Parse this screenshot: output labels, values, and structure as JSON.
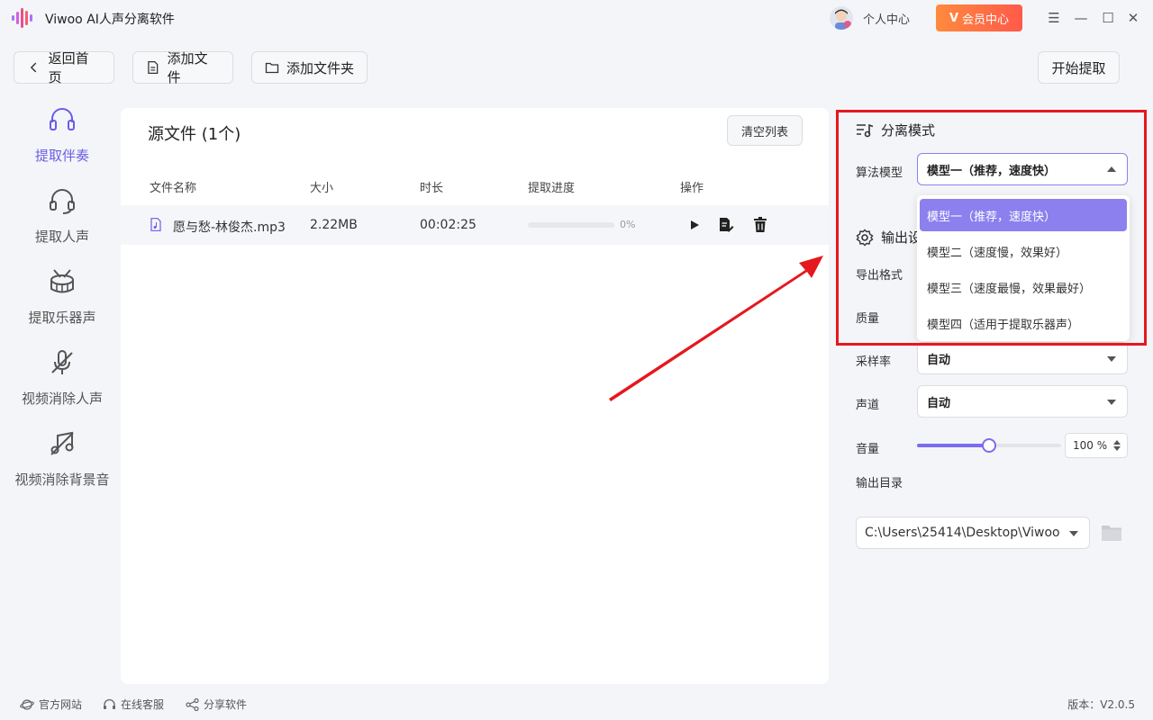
{
  "app": {
    "title": "Viwoo AI人声分离软件"
  },
  "titlebar": {
    "personal_center": "个人中心",
    "vip_center": "会员中心"
  },
  "toolbar": {
    "back": "返回首页",
    "add_file": "添加文件",
    "add_folder": "添加文件夹",
    "start": "开始提取"
  },
  "sidebar": {
    "items": [
      {
        "label": "提取伴奏",
        "active": true
      },
      {
        "label": "提取人声"
      },
      {
        "label": "提取乐器声"
      },
      {
        "label": "视频消除人声"
      },
      {
        "label": "视频消除背景音"
      }
    ]
  },
  "main": {
    "title": "源文件 (1个)",
    "clear_button": "清空列表",
    "columns": [
      "文件名称",
      "大小",
      "时长",
      "提取进度",
      "操作"
    ],
    "rows": [
      {
        "name": "愿与愁-林俊杰.mp3",
        "size": "2.22MB",
        "duration": "00:02:25",
        "progress_label": "0%",
        "progress": 0
      }
    ]
  },
  "settings": {
    "separation_title": "分离模式",
    "algorithm_label": "算法模型",
    "algorithm_value": "模型一（推荐，速度快）",
    "algorithm_options": [
      "模型一（推荐，速度快）",
      "模型二（速度慢，效果好）",
      "模型三（速度最慢，效果最好）",
      "模型四（适用于提取乐器声）"
    ],
    "output_title_visible": "输出设",
    "format_label": "导出格式",
    "quality_label": "质量",
    "samplerate_label": "采样率",
    "samplerate_value": "自动",
    "channel_label": "声道",
    "channel_value": "自动",
    "volume_label": "音量",
    "volume_value": "100 %",
    "volume_level": 0.5,
    "outdir_label": "输出目录",
    "outdir_value": "C:\\Users\\25414\\Desktop\\Viwoo"
  },
  "footer": {
    "website": "官方网站",
    "support": "在线客服",
    "share": "分享软件",
    "version": "版本：V2.0.5"
  },
  "colors": {
    "accent": "#7b6cf0",
    "highlight": "#e5181e",
    "vip": "#ff5a4a"
  }
}
